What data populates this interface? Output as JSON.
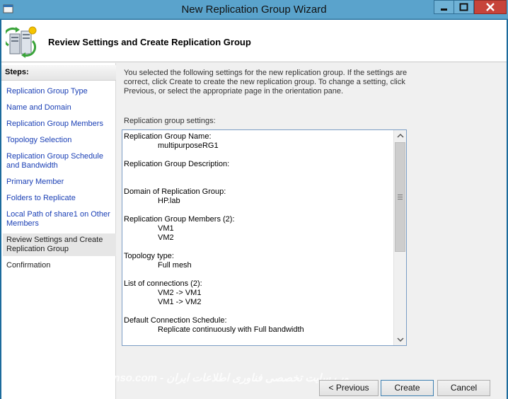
{
  "window": {
    "title": "New Replication Group Wizard"
  },
  "header": {
    "title": "Review Settings and Create Replication Group",
    "icon": "replication-server-icon"
  },
  "steps": {
    "heading": "Steps:",
    "items": [
      {
        "label": "Replication Group Type",
        "state": "link"
      },
      {
        "label": "Name and Domain",
        "state": "link"
      },
      {
        "label": "Replication Group Members",
        "state": "link"
      },
      {
        "label": "Topology Selection",
        "state": "link"
      },
      {
        "label": "Replication Group Schedule and Bandwidth",
        "state": "link"
      },
      {
        "label": "Primary Member",
        "state": "link"
      },
      {
        "label": "Folders to Replicate",
        "state": "link"
      },
      {
        "label": "Local Path of share1 on Other Members",
        "state": "link"
      },
      {
        "label": "Review Settings and Create Replication Group",
        "state": "current"
      },
      {
        "label": "Confirmation",
        "state": "disabled"
      }
    ]
  },
  "main": {
    "intro": "You selected the following settings for the new replication group. If the settings are correct, click Create to create the new replication group. To change a setting, click Previous, or select the appropriate page in the orientation pane.",
    "settings_label": "Replication group settings:",
    "settings": [
      {
        "label": "Replication Group Name:",
        "values": [
          "multipurposeRG1"
        ]
      },
      {
        "label": "Replication Group Description:",
        "values": [
          ""
        ]
      },
      {
        "label": "Domain of Replication Group:",
        "values": [
          "HP.lab"
        ]
      },
      {
        "label": "Replication Group Members (2):",
        "values": [
          "VM1",
          "VM2"
        ]
      },
      {
        "label": "Topology type:",
        "values": [
          "Full mesh"
        ]
      },
      {
        "label": "List of connections (2):",
        "values": [
          "VM2 -> VM1",
          "VM1 -> VM2"
        ]
      },
      {
        "label": "Default Connection Schedule:",
        "values": [
          "Replicate continuously with Full bandwidth"
        ]
      }
    ]
  },
  "buttons": {
    "previous": "< Previous",
    "create": "Create",
    "cancel": "Cancel"
  },
  "watermark": {
    "left": "TOSINSO.COM",
    "center": "Tosinso.com - وب سایت تخصصی فناوری اطلاعات ایران"
  },
  "colors": {
    "titlebar": "#5aa3cc",
    "close_button": "#c7443a",
    "link": "#1a3fb5",
    "settings_border": "#7a9cc4"
  }
}
